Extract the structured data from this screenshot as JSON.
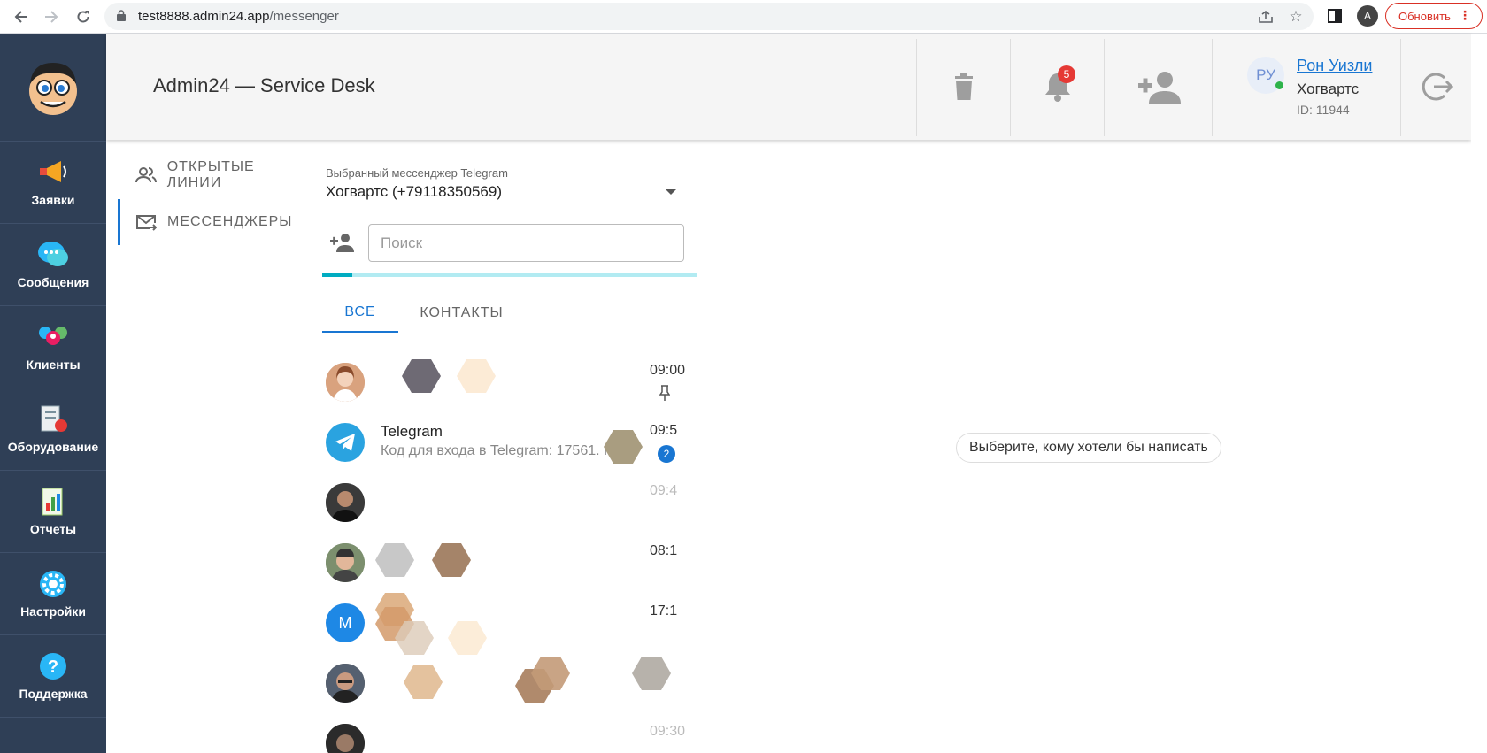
{
  "browser": {
    "url_host": "test8888.admin24.app",
    "url_path": "/messenger",
    "profile_initial": "A",
    "update_label": "Обновить"
  },
  "sidebar": {
    "items": [
      {
        "label": "Заявки",
        "icon": "megaphone-icon"
      },
      {
        "label": "Сообщения",
        "icon": "chat-bubbles-icon"
      },
      {
        "label": "Клиенты",
        "icon": "clients-icon"
      },
      {
        "label": "Оборудование",
        "icon": "equipment-icon"
      },
      {
        "label": "Отчеты",
        "icon": "reports-icon"
      },
      {
        "label": "Настройки",
        "icon": "gear-icon"
      },
      {
        "label": "Поддержка",
        "icon": "help-icon"
      }
    ]
  },
  "header": {
    "title": "Admin24 — Service Desk",
    "notifications_count": "5",
    "user": {
      "initials": "РУ",
      "name": "Рон Уизли",
      "org": "Хогвартс",
      "id": "ID: 11944"
    }
  },
  "menu": {
    "items": [
      {
        "label": "ОТКРЫТЫЕ ЛИНИИ",
        "active": false
      },
      {
        "label": "МЕССЕНДЖЕРЫ",
        "active": true
      }
    ]
  },
  "messenger": {
    "select_label": "Выбранный мессенджер Telegram",
    "select_value": "Хогвартс (+79118350569)",
    "search_placeholder": "Поиск",
    "progress": 0.08,
    "tabs": [
      {
        "label": "ВСЕ",
        "active": true
      },
      {
        "label": "КОНТАКТЫ",
        "active": false
      }
    ],
    "chats": [
      {
        "name": "",
        "preview": "",
        "time": "09:00",
        "pinned": true,
        "avatar": "photo-female",
        "unread": ""
      },
      {
        "name": "Telegram",
        "preview": "Код для входа в Telegram: 17561. Не да",
        "time": "09:5",
        "pinned": false,
        "avatar": "telegram",
        "unread": "2"
      },
      {
        "name": "",
        "preview": "",
        "time": "09:4",
        "pinned": false,
        "avatar": "photo-male-dark",
        "unread": ""
      },
      {
        "name": "",
        "preview": "",
        "time": "08:1",
        "pinned": false,
        "avatar": "photo-male-light",
        "unread": ""
      },
      {
        "name": "",
        "preview": "",
        "time": "17:1",
        "pinned": false,
        "avatar": "letter-M",
        "avatar_letter": "M",
        "unread": ""
      },
      {
        "name": "",
        "preview": "",
        "time": "",
        "pinned": false,
        "avatar": "photo-male-glasses",
        "unread": ""
      },
      {
        "name": "",
        "preview": "",
        "time": "09:30",
        "pinned": false,
        "avatar": "photo-partial",
        "unread": ""
      }
    ]
  },
  "empty_state": "Выберите, кому хотели бы написать",
  "colors": {
    "sidebar_bg": "#2f3f56",
    "accent": "#1976d2",
    "badge": "#e53935",
    "progress": "#00acc1",
    "online": "#2eb34a"
  }
}
